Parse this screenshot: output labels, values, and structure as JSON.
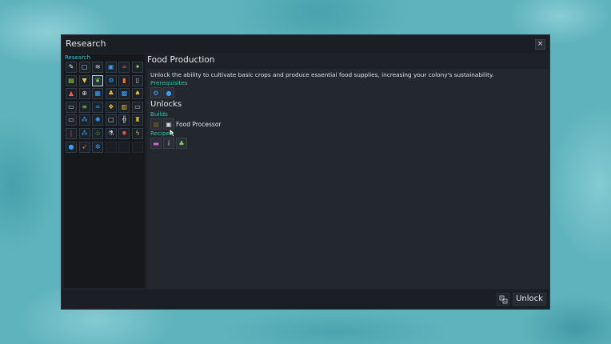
{
  "window": {
    "title": "Research",
    "close_glyph": "×"
  },
  "tree": {
    "label": "Research",
    "nodes": [
      {
        "icon": "dropper-icon",
        "glyph": "✎",
        "color": "#e8e8e8"
      },
      {
        "icon": "monitor-icon",
        "glyph": "▢",
        "color": "#cfd6dd"
      },
      {
        "icon": "layers-icon",
        "glyph": "≋",
        "color": "#cfd6dd"
      },
      {
        "icon": "board-icon",
        "glyph": "▣",
        "color": "#3aa0ff"
      },
      {
        "icon": "link-icon",
        "glyph": "∞",
        "color": "#ff5a6e"
      },
      {
        "icon": "seed-icon",
        "glyph": "✦",
        "color": "#a8e04a"
      },
      {
        "icon": "circuit-icon",
        "glyph": "▤",
        "color": "#9be04a"
      },
      {
        "icon": "funnel-icon",
        "glyph": "▼",
        "color": "#f0c23a"
      },
      {
        "icon": "plant-icon",
        "glyph": "❦",
        "color": "#7ad94e"
      },
      {
        "icon": "gear-icon",
        "glyph": "⚙",
        "color": "#3aa0ff"
      },
      {
        "icon": "tube-icon",
        "glyph": "▮",
        "color": "#f07a3a"
      },
      {
        "icon": "bottle-icon",
        "glyph": "▯",
        "color": "#d0d0d0"
      },
      {
        "icon": "flask-icon",
        "glyph": "▲",
        "color": "#ff5a4a"
      },
      {
        "icon": "globe-icon",
        "glyph": "⊕",
        "color": "#d8d8d8"
      },
      {
        "icon": "chip-icon",
        "glyph": "▦",
        "color": "#3aa0ff"
      },
      {
        "icon": "wheat-icon",
        "glyph": "♣",
        "color": "#f0c23a"
      },
      {
        "icon": "grid-icon",
        "glyph": "▩",
        "color": "#3aa0ff"
      },
      {
        "icon": "bolt-icon",
        "glyph": "♠",
        "color": "#e8c03a"
      },
      {
        "icon": "computer-icon",
        "glyph": "▭",
        "color": "#d8d8d8"
      },
      {
        "icon": "conveyor-icon",
        "glyph": "≡",
        "color": "#7ad94e"
      },
      {
        "icon": "wave-icon",
        "glyph": "≈",
        "color": "#3aa0ff"
      },
      {
        "icon": "cluster-icon",
        "glyph": "❖",
        "color": "#f0c23a"
      },
      {
        "icon": "panel-icon",
        "glyph": "▥",
        "color": "#f0c23a"
      },
      {
        "icon": "display-icon",
        "glyph": "▭",
        "color": "#d0d0d0"
      },
      {
        "icon": "terminal-icon",
        "glyph": "▭",
        "color": "#d8d8d8"
      },
      {
        "icon": "molecule-icon",
        "glyph": "⁂",
        "color": "#3aa0ff"
      },
      {
        "icon": "atom-icon",
        "glyph": "✺",
        "color": "#3aa0ff"
      },
      {
        "icon": "window-icon",
        "glyph": "▢",
        "color": "#d8d8d8"
      },
      {
        "icon": "pipes-icon",
        "glyph": "╬",
        "color": "#d8d8d8"
      },
      {
        "icon": "tower-icon",
        "glyph": "♜",
        "color": "#f0c23a"
      },
      {
        "icon": "beam-icon",
        "glyph": "❘",
        "color": "#ff4a4a"
      },
      {
        "icon": "nodes-icon",
        "glyph": "⁂",
        "color": "#3aa0ff"
      },
      {
        "icon": "sprout-icon",
        "glyph": "♧",
        "color": "#7ad94e"
      },
      {
        "icon": "beaker-icon",
        "glyph": "⚗",
        "color": "#d8d8d8"
      },
      {
        "icon": "fire-icon",
        "glyph": "✹",
        "color": "#ff4a4a"
      },
      {
        "icon": "lightning-icon",
        "glyph": "ϟ",
        "color": "#f0c23a"
      },
      {
        "icon": "drop-icon",
        "glyph": "●",
        "color": "#3aa0ff"
      },
      {
        "icon": "rocket-icon",
        "glyph": "➶",
        "color": "#f07a3a"
      },
      {
        "icon": "cog-icon",
        "glyph": "✲",
        "color": "#3aa0ff"
      },
      {
        "icon": "",
        "glyph": "",
        "color": ""
      },
      {
        "icon": "",
        "glyph": "",
        "color": ""
      },
      {
        "icon": "",
        "glyph": "",
        "color": ""
      }
    ],
    "selected_index": 8
  },
  "detail": {
    "title": "Food Production",
    "description": "Unlock the ability to cultivate basic crops and produce essential food supplies, increasing your colony's sustainability.",
    "prerequisites_label": "Prerequisites",
    "prerequisites": [
      {
        "icon": "gear-icon",
        "glyph": "⚙",
        "color": "#3aa0ff"
      },
      {
        "icon": "drop-icon",
        "glyph": "●",
        "color": "#3aa0ff"
      }
    ],
    "unlocks_label": "Unlocks",
    "builds_label": "Builds",
    "builds": [
      {
        "icon": "crate-icon",
        "glyph": "■",
        "color": "#5a4a2a"
      },
      {
        "icon": "processor-icon",
        "glyph": "▣",
        "color": "#d8d8d8"
      }
    ],
    "build_name": "Food Processor",
    "recipes_label": "Recipes",
    "recipes": [
      {
        "icon": "ration-icon",
        "glyph": "▬",
        "color": "#d86ad8"
      },
      {
        "icon": "vial-icon",
        "glyph": "ỉ",
        "color": "#e0e0e0"
      },
      {
        "icon": "herb-icon",
        "glyph": "♣",
        "color": "#7ad94e"
      }
    ]
  },
  "footer": {
    "unlock_label": "Unlock"
  }
}
